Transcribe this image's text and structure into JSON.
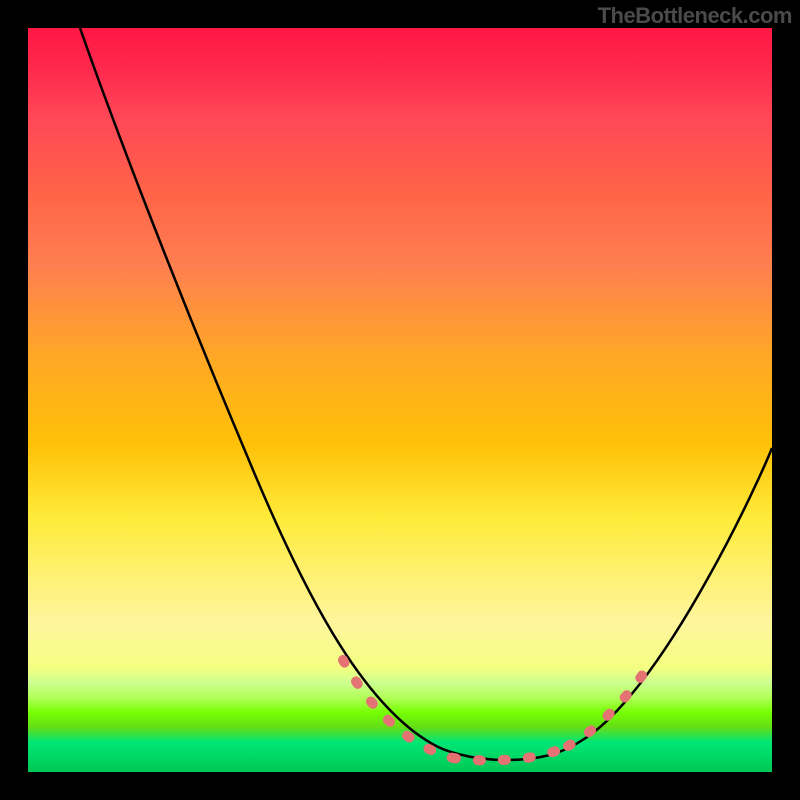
{
  "watermark": "TheBottleneck.com",
  "chart_data": {
    "type": "line",
    "title": "",
    "xlabel": "",
    "ylabel": "",
    "description": "Bottleneck V-curve over a vertical heat gradient. No numeric axes or tick labels are rendered. The curve descends steeply from the upper-left, reaches a flat minimum near the bottom (green zone), then rises toward the right. A salmon dotted overlay highlights the near-minimum region on both descending and ascending sides.",
    "gradient_stops": [
      {
        "pos": 0.0,
        "color": "#ff1744"
      },
      {
        "pos": 0.12,
        "color": "#ff4757"
      },
      {
        "pos": 0.32,
        "color": "#ff7f50"
      },
      {
        "pos": 0.56,
        "color": "#ffc107"
      },
      {
        "pos": 0.74,
        "color": "#fff176"
      },
      {
        "pos": 0.88,
        "color": "#ccff90"
      },
      {
        "pos": 0.96,
        "color": "#00e676"
      },
      {
        "pos": 1.0,
        "color": "#00c853"
      }
    ],
    "series": [
      {
        "name": "bottleneck-curve",
        "style": "solid",
        "color": "#000000",
        "points_norm": [
          {
            "x": 0.07,
            "y": 1.0
          },
          {
            "x": 0.3,
            "y": 0.42
          },
          {
            "x": 0.45,
            "y": 0.11
          },
          {
            "x": 0.58,
            "y": 0.02
          },
          {
            "x": 0.64,
            "y": 0.02
          },
          {
            "x": 0.72,
            "y": 0.04
          },
          {
            "x": 0.84,
            "y": 0.16
          },
          {
            "x": 0.92,
            "y": 0.28
          },
          {
            "x": 1.0,
            "y": 0.44
          }
        ]
      },
      {
        "name": "optimal-range-highlight",
        "style": "dotted",
        "color": "#e57373",
        "points_norm": [
          {
            "x": 0.42,
            "y": 0.15
          },
          {
            "x": 0.52,
            "y": 0.04
          },
          {
            "x": 0.58,
            "y": 0.02
          },
          {
            "x": 0.65,
            "y": 0.02
          },
          {
            "x": 0.73,
            "y": 0.04
          },
          {
            "x": 0.84,
            "y": 0.15
          }
        ]
      }
    ],
    "xlim": [
      0,
      1
    ],
    "ylim": [
      0,
      1
    ],
    "axes_visible": false,
    "grid": false
  }
}
